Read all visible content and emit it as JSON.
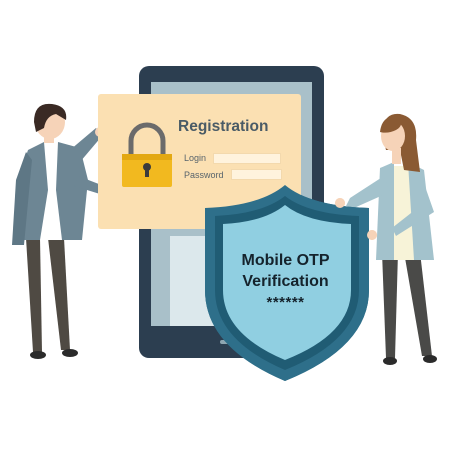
{
  "registration": {
    "title": "Registration",
    "login_label": "Login",
    "password_label": "Password"
  },
  "shield": {
    "line1": "Mobile OTP",
    "line2": "Verification",
    "line3": "******"
  },
  "icons": [
    "padlock-icon",
    "shield-icon",
    "smartphone-icon"
  ],
  "colors": {
    "phone_frame": "#2c3e50",
    "phone_screen": "#a9c0c9",
    "card_background": "#fbe0b2",
    "padlock": "#f2b91f",
    "shield_outer": "#2e6f8a",
    "shield_inner": "#90cfe1",
    "man_jacket": "#6d8694",
    "woman_cardigan": "#a3c2cc"
  }
}
